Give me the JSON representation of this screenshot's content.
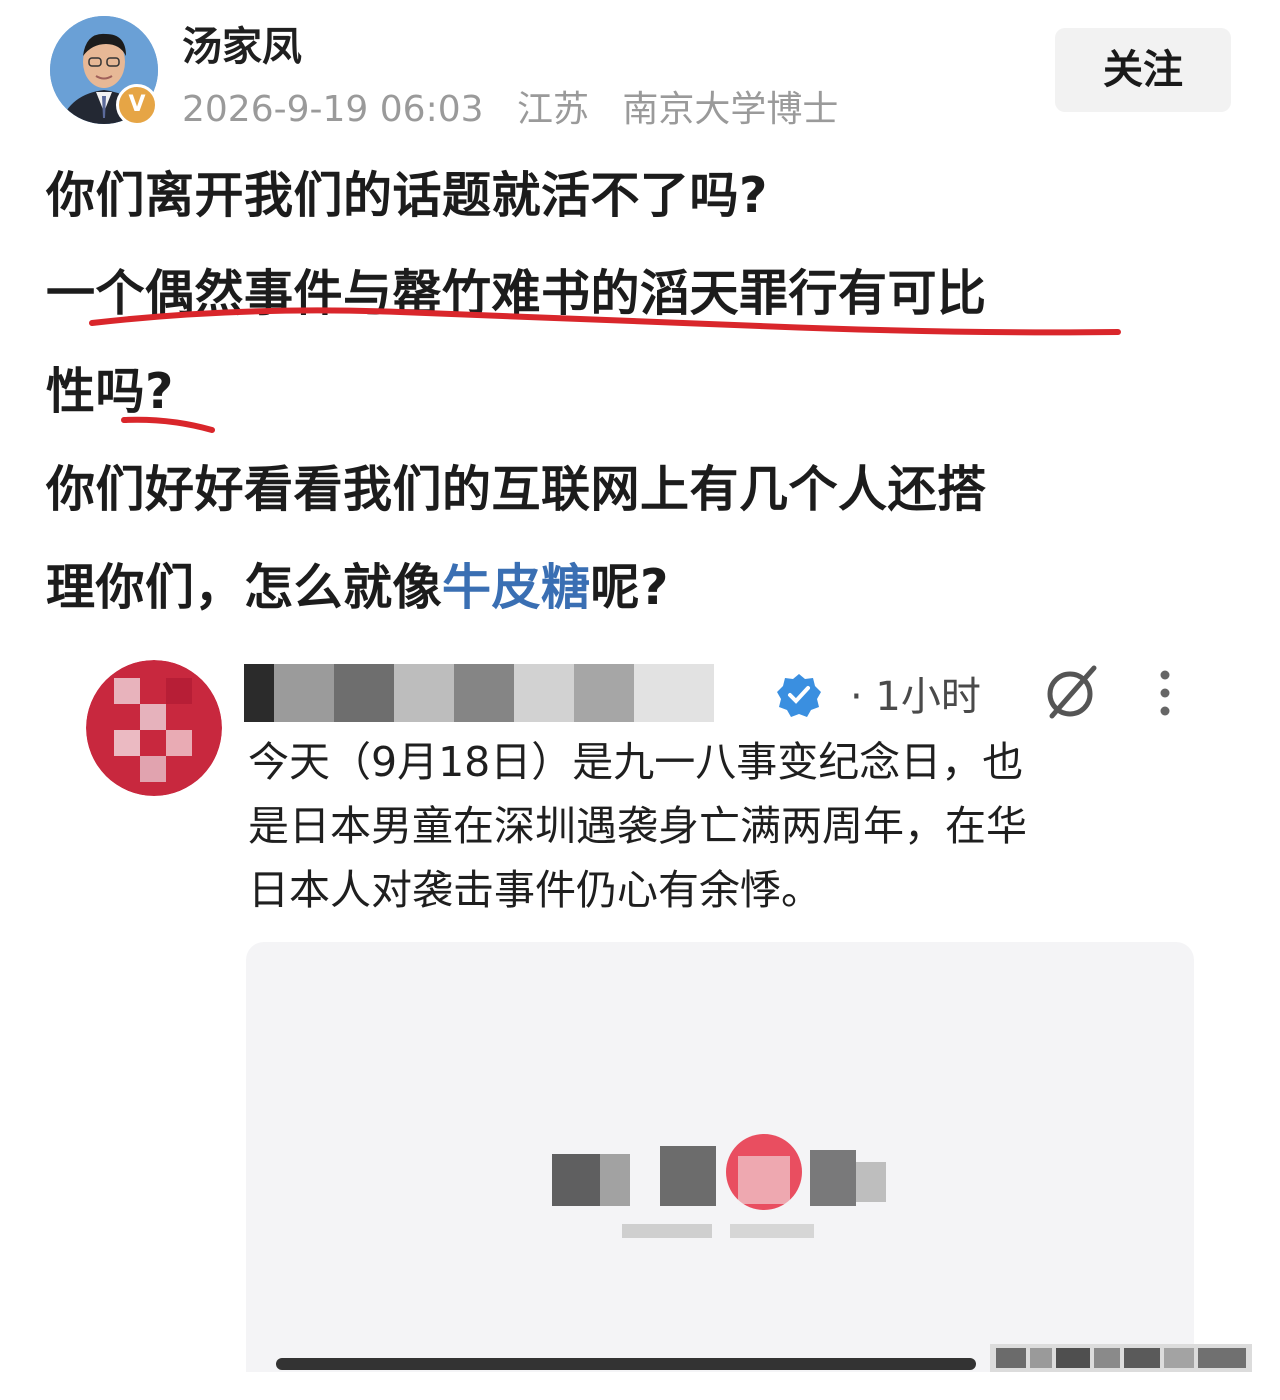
{
  "post": {
    "author": "汤家凤",
    "verified_badge": "V",
    "date": "2026-9-19 06:03",
    "location": "江苏",
    "title": "南京大学博士",
    "follow_label": "关注",
    "lines": [
      "你们离开我们的话题就活不了吗?",
      "一个偶然事件与罄竹难书的滔天罪行有可比",
      "性吗?",
      "你们好好看看我们的互联网上有几个人还搭"
    ],
    "line5_prefix": "理你们，怎么就像",
    "line5_link": "牛皮糖",
    "line5_suffix": "呢?"
  },
  "quoted_post": {
    "time": "· 1小时",
    "lines": [
      "今天（9月18日）是九一八事变纪念日，也",
      "是日本男童在深圳遇袭身亡满两周年，在华",
      "日本人对袭击事件仍心有余悸。"
    ],
    "icons": {
      "verified": "verified-check-icon",
      "grok": "grok-icon",
      "more": "more-vertical-icon"
    }
  },
  "colors": {
    "link": "#3a6fb3",
    "annotation_red": "#d9262b",
    "badge": "#e6a545",
    "verified_blue": "#3a8fe0"
  }
}
